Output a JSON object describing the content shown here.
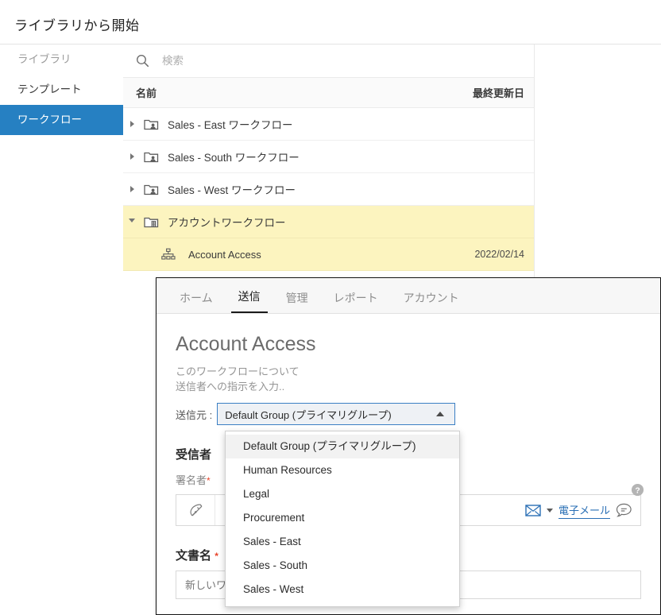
{
  "library": {
    "title": "ライブラリから開始",
    "sidebar": {
      "items": [
        {
          "label": "ライブラリ",
          "state": "muted"
        },
        {
          "label": "テンプレート",
          "state": "normal"
        },
        {
          "label": "ワークフロー",
          "state": "active"
        }
      ]
    },
    "search": {
      "value": "",
      "placeholder": "検索",
      "icon": "search-icon"
    },
    "columns": {
      "name": "名前",
      "last_modified": "最終更新日"
    },
    "rows": [
      {
        "label": "Sales - East ワークフロー",
        "date": "",
        "icon": "folder-user-icon",
        "expanded": false,
        "level": 0,
        "highlight": false
      },
      {
        "label": "Sales - South ワークフロー",
        "date": "",
        "icon": "folder-user-icon",
        "expanded": false,
        "level": 0,
        "highlight": false
      },
      {
        "label": "Sales - West ワークフロー",
        "date": "",
        "icon": "folder-user-icon",
        "expanded": false,
        "level": 0,
        "highlight": false
      },
      {
        "label": "アカウントワークフロー",
        "date": "",
        "icon": "folder-building-icon",
        "expanded": true,
        "level": 0,
        "highlight": true
      },
      {
        "label": "Account Access",
        "date": "2022/02/14",
        "icon": "workflow-node-icon",
        "expanded": null,
        "level": 1,
        "highlight": true
      }
    ]
  },
  "send_modal": {
    "tabs": [
      {
        "label": "ホーム",
        "active": false
      },
      {
        "label": "送信",
        "active": true
      },
      {
        "label": "管理",
        "active": false
      },
      {
        "label": "レポート",
        "active": false
      },
      {
        "label": "アカウント",
        "active": false
      }
    ],
    "heading": "Account Access",
    "description_lines": [
      "このワークフローについて",
      "送信者への指示を入力.."
    ],
    "sender": {
      "label": "送信元 :",
      "value": "Default Group (プライマリグループ)",
      "caret": "chevron-up-icon",
      "options": [
        {
          "label": "Default Group (プライマリグループ)",
          "selected": true
        },
        {
          "label": "Human Resources",
          "selected": false
        },
        {
          "label": "Legal",
          "selected": false
        },
        {
          "label": "Procurement",
          "selected": false
        },
        {
          "label": "Sales - East",
          "selected": false
        },
        {
          "label": "Sales - South",
          "selected": false
        },
        {
          "label": "Sales - West",
          "selected": false
        }
      ]
    },
    "recipients": {
      "title": "受信者",
      "signer_label": "署名者",
      "required_mark": "*",
      "signature_icon": "pen-nib-icon",
      "delivery_icon": "envelope-icon",
      "delivery_caret": "chevron-down-icon",
      "delivery_label": "電子メール",
      "message_icon": "speech-bubble-icon"
    },
    "document_name": {
      "title": "文書名",
      "required_mark": "*",
      "value": "",
      "placeholder": "新しいワ"
    },
    "help_icon": "help-circle-icon"
  },
  "colors": {
    "accent": "#2680c2",
    "highlight": "#fcf4bf",
    "link": "#2a6fb5",
    "required": "#e8452c"
  }
}
